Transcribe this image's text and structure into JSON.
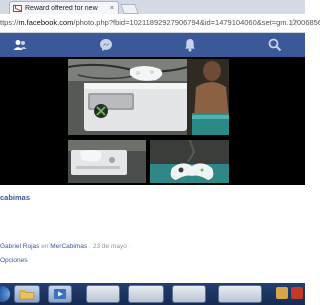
{
  "browser": {
    "tab_title": "Reward offered for new",
    "tab_close": "×",
    "url_prefix": "ttps://",
    "url_domain": "m.facebook.com",
    "url_rest": "/photo.php?fbid=10211892927906794&id=1479104060&set=gm.17006856"
  },
  "nav": {
    "icons": [
      "friends-icon",
      "messenger-icon",
      "notifications-icon",
      "search-icon"
    ]
  },
  "post": {
    "group_name": "cabimas",
    "author": "Gabriel Rojas",
    "in_word": "en",
    "group_ref": "MerCabimas",
    "date": "· 23 de mayo ·",
    "options_label": "Opciones"
  },
  "colors": {
    "facebook_blue": "#3b5998",
    "photo_background": "#000000",
    "taskbar": "#1b3461"
  }
}
